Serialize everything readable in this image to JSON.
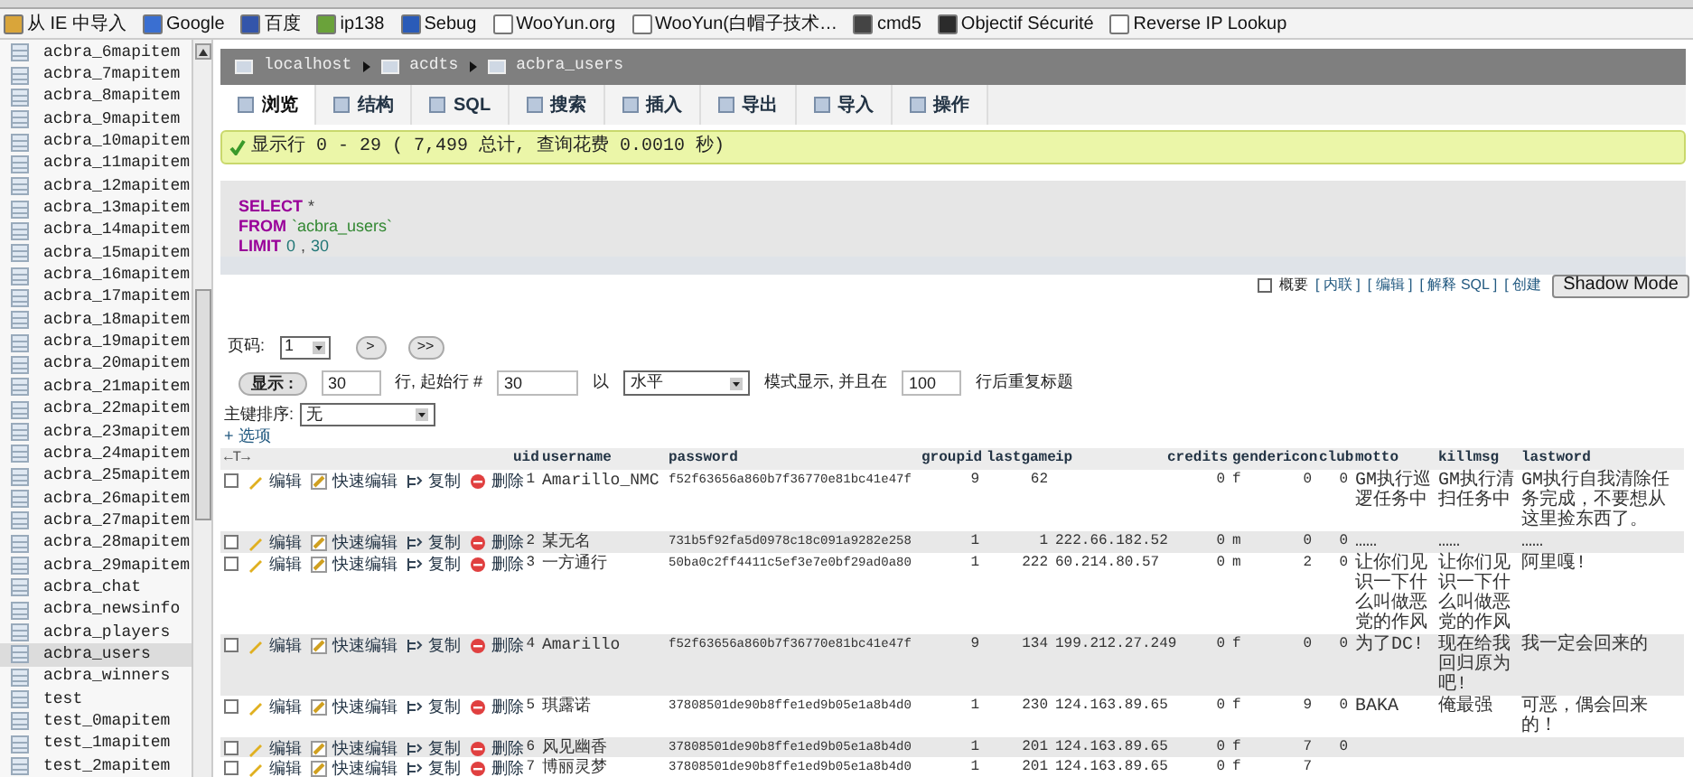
{
  "bookmarks": [
    "从 IE 中导入",
    "Google",
    "百度",
    "ip138",
    "Sebug",
    "WooYun.org",
    "WooYun(白帽子技术…",
    "cmd5",
    "Objectif Sécurité",
    "Reverse IP Lookup"
  ],
  "sidebar": {
    "items": [
      {
        "label": "acbra_6mapitem",
        "selected": false
      },
      {
        "label": "acbra_7mapitem",
        "selected": false
      },
      {
        "label": "acbra_8mapitem",
        "selected": false
      },
      {
        "label": "acbra_9mapitem",
        "selected": false
      },
      {
        "label": "acbra_10mapitem",
        "selected": false
      },
      {
        "label": "acbra_11mapitem",
        "selected": false
      },
      {
        "label": "acbra_12mapitem",
        "selected": false
      },
      {
        "label": "acbra_13mapitem",
        "selected": false
      },
      {
        "label": "acbra_14mapitem",
        "selected": false
      },
      {
        "label": "acbra_15mapitem",
        "selected": false
      },
      {
        "label": "acbra_16mapitem",
        "selected": false
      },
      {
        "label": "acbra_17mapitem",
        "selected": false
      },
      {
        "label": "acbra_18mapitem",
        "selected": false
      },
      {
        "label": "acbra_19mapitem",
        "selected": false
      },
      {
        "label": "acbra_20mapitem",
        "selected": false
      },
      {
        "label": "acbra_21mapitem",
        "selected": false
      },
      {
        "label": "acbra_22mapitem",
        "selected": false
      },
      {
        "label": "acbra_23mapitem",
        "selected": false
      },
      {
        "label": "acbra_24mapitem",
        "selected": false
      },
      {
        "label": "acbra_25mapitem",
        "selected": false
      },
      {
        "label": "acbra_26mapitem",
        "selected": false
      },
      {
        "label": "acbra_27mapitem",
        "selected": false
      },
      {
        "label": "acbra_28mapitem",
        "selected": false
      },
      {
        "label": "acbra_29mapitem",
        "selected": false
      },
      {
        "label": "acbra_chat",
        "selected": false
      },
      {
        "label": "acbra_newsinfo",
        "selected": false
      },
      {
        "label": "acbra_players",
        "selected": false
      },
      {
        "label": "acbra_users",
        "selected": true
      },
      {
        "label": "acbra_winners",
        "selected": false
      },
      {
        "label": "test",
        "selected": false
      },
      {
        "label": "test_0mapitem",
        "selected": false
      },
      {
        "label": "test_1mapitem",
        "selected": false
      },
      {
        "label": "test_2mapitem",
        "selected": false
      }
    ]
  },
  "breadcrumb": [
    "localhost",
    "acdts",
    "acbra_users"
  ],
  "tabs": [
    {
      "label": "浏览",
      "selected": true
    },
    {
      "label": "结构",
      "selected": false
    },
    {
      "label": "SQL",
      "selected": false
    },
    {
      "label": "搜索",
      "selected": false
    },
    {
      "label": "插入",
      "selected": false
    },
    {
      "label": "导出",
      "selected": false
    },
    {
      "label": "导入",
      "selected": false
    },
    {
      "label": "操作",
      "selected": false
    }
  ],
  "message": "显示行 0 - 29 ( 7,499 总计, 查询花费 0.0010 秒)",
  "sql": [
    [
      {
        "kind": "keyword",
        "text": "SELECT"
      },
      {
        "kind": "plain",
        "text": "*"
      }
    ],
    [
      {
        "kind": "keyword",
        "text": "FROM"
      },
      {
        "kind": "name",
        "text": "`acbra_users`"
      }
    ],
    [
      {
        "kind": "keyword",
        "text": "LIMIT"
      },
      {
        "kind": "number",
        "text": "0"
      },
      {
        "kind": "plain",
        "text": ","
      },
      {
        "kind": "number",
        "text": "30"
      }
    ]
  ],
  "query_options": {
    "profiling": {
      "label": "概要",
      "checked": false
    },
    "links": [
      "[ 内联 ]",
      "[ 编辑 ]",
      "[ 解释 SQL ]",
      "[ 创建"
    ],
    "shadow_button": "Shadow Mode"
  },
  "pager": {
    "page_label": "页码:",
    "page": "1",
    "next": ">",
    "last": ">>"
  },
  "display": {
    "button": "显示 :",
    "rows": "30",
    "text1": "行, 起始行 #",
    "start": "30",
    "text2": "以",
    "mode": "水平",
    "text3": "模式显示, 并且在",
    "repeat": "100",
    "text4": "行后重复标题"
  },
  "sort": {
    "label": "主键排序:",
    "value": "无"
  },
  "options_link": "+ 选项",
  "table": {
    "arrows": "←T→",
    "columns": [
      "uid",
      "username",
      "password",
      "groupid",
      "lastgame",
      "ip",
      "credits",
      "gender",
      "icon",
      "club",
      "motto",
      "killmsg",
      "lastword"
    ],
    "rows": [
      {
        "checked": false,
        "actions": [
          "编辑",
          "快速编辑",
          "复制",
          "删除"
        ],
        "cells": [
          "1",
          "Amarillo_NMC",
          "f52f63656a860b7f36770e81bc41e47f",
          "9",
          "62",
          "",
          "0",
          "f",
          "0",
          "0",
          "GM执行巡逻任务中",
          "GM执行清扫任务中",
          "GM执行自我清除任务完成，不要想从这里捡东西了。"
        ]
      },
      {
        "checked": false,
        "actions": [
          "编辑",
          "快速编辑",
          "复制",
          "删除"
        ],
        "cells": [
          "2",
          "某无名",
          "731b5f92fa5d0978c18c091a9282e258",
          "1",
          "1",
          "222.66.182.52",
          "0",
          "m",
          "0",
          "0",
          "……",
          "……",
          "……"
        ]
      },
      {
        "checked": false,
        "actions": [
          "编辑",
          "快速编辑",
          "复制",
          "删除"
        ],
        "cells": [
          "3",
          "一方通行",
          "50ba0c2ff4411c5ef3e7e0bf29ad0a80",
          "1",
          "222",
          "60.214.80.57",
          "0",
          "m",
          "2",
          "0",
          "让你们见识一下什么叫做恶党的作风",
          "让你们见识一下什么叫做恶党的作风",
          "阿里嘎!"
        ]
      },
      {
        "checked": false,
        "actions": [
          "编辑",
          "快速编辑",
          "复制",
          "删除"
        ],
        "cells": [
          "4",
          "Amarillo",
          "f52f63656a860b7f36770e81bc41e47f",
          "9",
          "134",
          "199.212.27.249",
          "0",
          "f",
          "0",
          "0",
          "为了DC!",
          "现在给我回归原为吧!",
          "我一定会回来的"
        ]
      },
      {
        "checked": false,
        "actions": [
          "编辑",
          "快速编辑",
          "复制",
          "删除"
        ],
        "cells": [
          "5",
          "琪露诺",
          "37808501de90b8ffe1ed9b05e1a8b4d0",
          "1",
          "230",
          "124.163.89.65",
          "0",
          "f",
          "9",
          "0",
          "BAKA",
          "俺最强",
          "可恶，偶会回来的！"
        ]
      },
      {
        "checked": false,
        "actions": [
          "编辑",
          "快速编辑",
          "复制",
          "删除"
        ],
        "cells": [
          "6",
          "风见幽香",
          "37808501de90b8ffe1ed9b05e1a8b4d0",
          "1",
          "201",
          "124.163.89.65",
          "0",
          "f",
          "7",
          "0",
          "",
          "",
          ""
        ]
      },
      {
        "checked": false,
        "actions": [
          "编辑",
          "快速编辑",
          "复制",
          "删除"
        ],
        "cells": [
          "7",
          "博丽灵梦",
          "37808501de90b8ffe1ed9b05e1a8b4d0",
          "1",
          "201",
          "124.163.89.65",
          "0",
          "f",
          "7",
          "",
          "",
          "",
          ""
        ]
      }
    ]
  }
}
